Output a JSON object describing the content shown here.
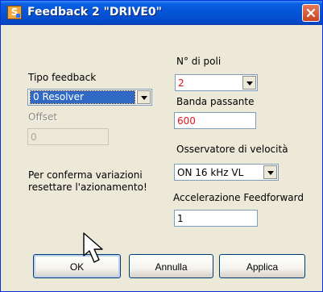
{
  "window": {
    "title": "Feedback 2 \"DRIVE0\"",
    "icon_letter": "S"
  },
  "form": {
    "tipo_feedback": {
      "label": "Tipo feedback",
      "value": "0 Resolver"
    },
    "offset": {
      "label": "Offset",
      "value": "0"
    },
    "note": {
      "line1": "Per conferma variazioni",
      "line2": "resettare l'azionamento!"
    },
    "n_poli": {
      "label": "N° di poli",
      "value": "2"
    },
    "banda_passante": {
      "label": "Banda passante",
      "value": "600"
    },
    "osservatore": {
      "label": "Osservatore di velocità",
      "value": "ON  16 kHz VL"
    },
    "accelerazione": {
      "label": "Accelerazione Feedforward",
      "value": "1"
    }
  },
  "buttons": {
    "ok": "OK",
    "annulla": "Annulla",
    "applica": "Applica"
  },
  "colors": {
    "title_bar": "#0554d6",
    "dialog_bg": "#ece9d8",
    "value_red": "#e0141e",
    "selection": "#316ac5"
  }
}
